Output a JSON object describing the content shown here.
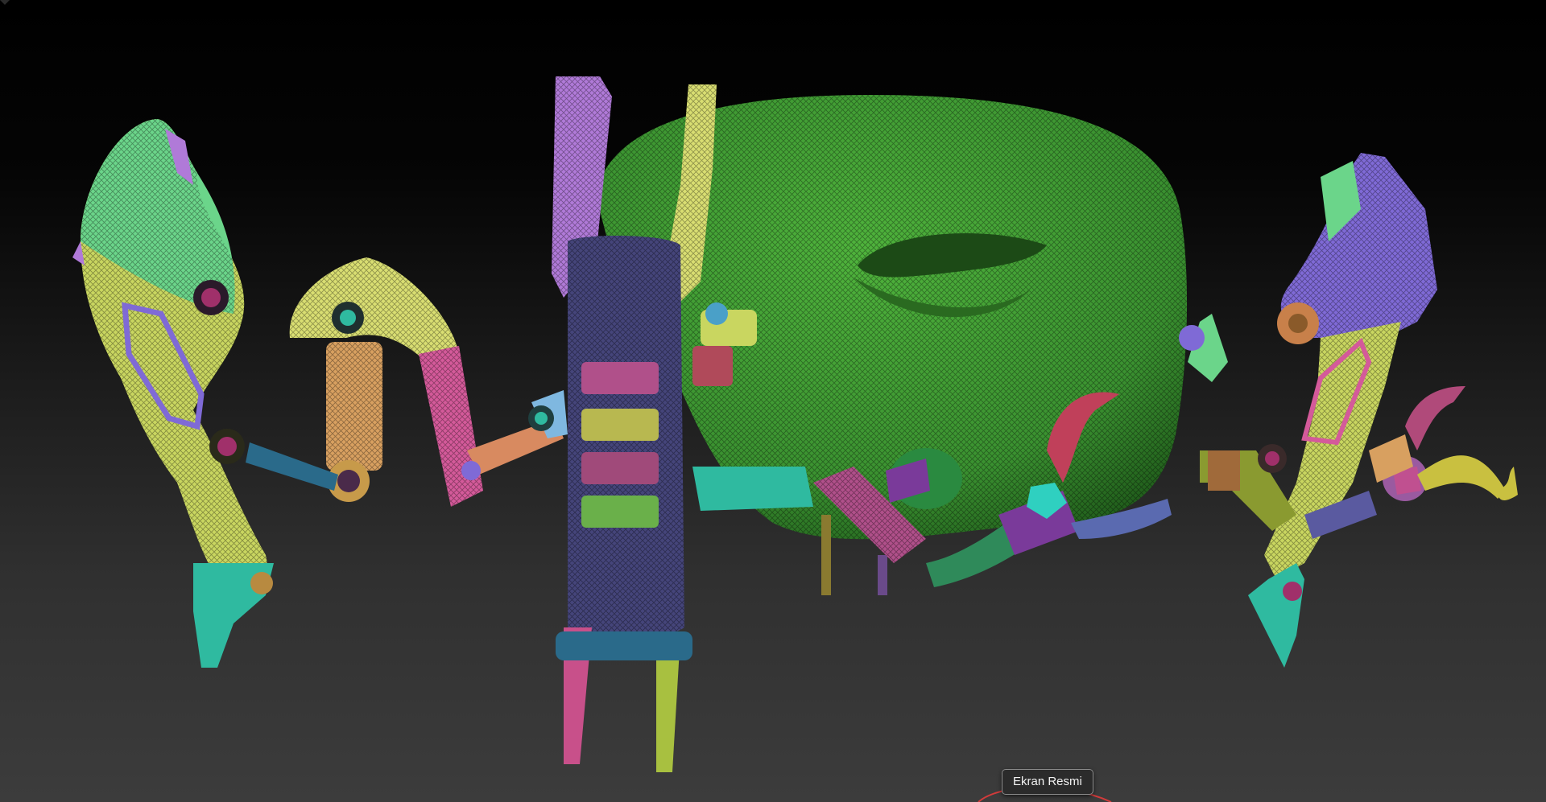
{
  "tooltip": {
    "label": "Ekran Resmi"
  },
  "colors": {
    "background_top": "#000000",
    "background_bottom": "#3c3c3c",
    "head_green": "#3f9a34",
    "part_lime": "#7fe089",
    "part_yellow": "#d9de72",
    "part_purple": "#b07ad8",
    "part_violet": "#7f6ad6",
    "part_navy": "#45457a",
    "part_pink": "#d45a9a",
    "part_teal": "#2fbaa0",
    "part_orange": "#d8a060",
    "selection_ring": "#d23b3b"
  },
  "viewport_icons": [
    "robot-mesh-model"
  ]
}
